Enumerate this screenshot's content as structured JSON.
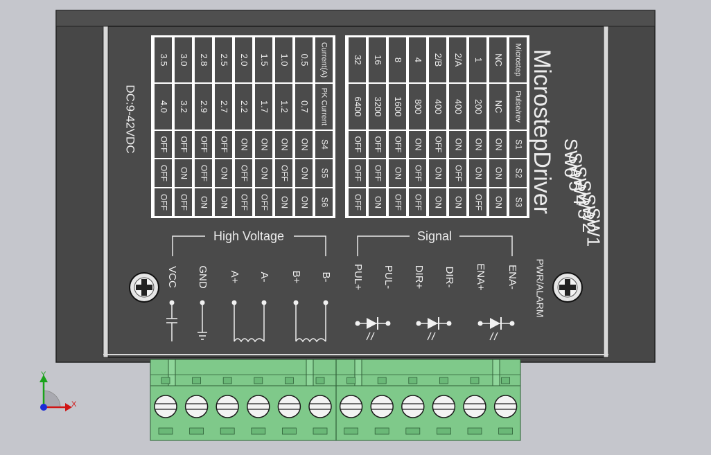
{
  "background_color": "#c5c6cc",
  "device": {
    "title": "MicrostepDriver",
    "supply_label": "DC:9-42VDC",
    "pwr_alarm_label": "PWR/ALARM",
    "switch_labels": [
      "SW6",
      "SW5",
      "SW4",
      "SW3",
      "SW2",
      "SW1"
    ],
    "body_color": "#4a4a4a",
    "terminal_color": "#7fc98a"
  },
  "current_table": {
    "header_current": "Current(A)",
    "header_pk_current": "PK Current",
    "header_switches": [
      "S4",
      "S5",
      "S6"
    ],
    "rows": [
      {
        "current": "0.5",
        "pk": "0.7",
        "s4": "ON",
        "s5": "ON",
        "s6": "ON"
      },
      {
        "current": "1.0",
        "pk": "1.2",
        "s4": "ON",
        "s5": "OFF",
        "s6": "ON"
      },
      {
        "current": "1.5",
        "pk": "1.7",
        "s4": "ON",
        "s5": "ON",
        "s6": "OFF"
      },
      {
        "current": "2.0",
        "pk": "2.2",
        "s4": "ON",
        "s5": "OFF",
        "s6": "OFF"
      },
      {
        "current": "2.5",
        "pk": "2.7",
        "s4": "OFF",
        "s5": "ON",
        "s6": "ON"
      },
      {
        "current": "2.8",
        "pk": "2.9",
        "s4": "OFF",
        "s5": "OFF",
        "s6": "ON"
      },
      {
        "current": "3.0",
        "pk": "3.2",
        "s4": "OFF",
        "s5": "ON",
        "s6": "OFF"
      },
      {
        "current": "3.5",
        "pk": "4.0",
        "s4": "OFF",
        "s5": "OFF",
        "s6": "OFF"
      }
    ]
  },
  "microstep_table": {
    "header_microstep": "Microstep",
    "header_pulse_rev": "Pulse/rev",
    "header_switches": [
      "S1",
      "S2",
      "S3"
    ],
    "rows": [
      {
        "microstep": "NC",
        "pulse": "NC",
        "s1": "ON",
        "s2": "ON",
        "s3": "ON"
      },
      {
        "microstep": "1",
        "pulse": "200",
        "s1": "ON",
        "s2": "ON",
        "s3": "OFF"
      },
      {
        "microstep": "2/A",
        "pulse": "400",
        "s1": "ON",
        "s2": "OFF",
        "s3": "ON"
      },
      {
        "microstep": "2/B",
        "pulse": "400",
        "s1": "OFF",
        "s2": "ON",
        "s3": "ON"
      },
      {
        "microstep": "4",
        "pulse": "800",
        "s1": "ON",
        "s2": "OFF",
        "s3": "OFF"
      },
      {
        "microstep": "8",
        "pulse": "1600",
        "s1": "OFF",
        "s2": "ON",
        "s3": "OFF"
      },
      {
        "microstep": "16",
        "pulse": "3200",
        "s1": "OFF",
        "s2": "OFF",
        "s3": "ON"
      },
      {
        "microstep": "32",
        "pulse": "6400",
        "s1": "OFF",
        "s2": "OFF",
        "s3": "OFF"
      }
    ]
  },
  "groups": {
    "high_voltage": "High Voltage",
    "signal": "Signal"
  },
  "terminals": [
    "VCC",
    "GND",
    "A+",
    "A-",
    "B+",
    "B-",
    "PUL+",
    "PUL-",
    "DIR+",
    "DIR-",
    "ENA+",
    "ENA-"
  ],
  "axes": {
    "x": "X",
    "y": "Y"
  }
}
